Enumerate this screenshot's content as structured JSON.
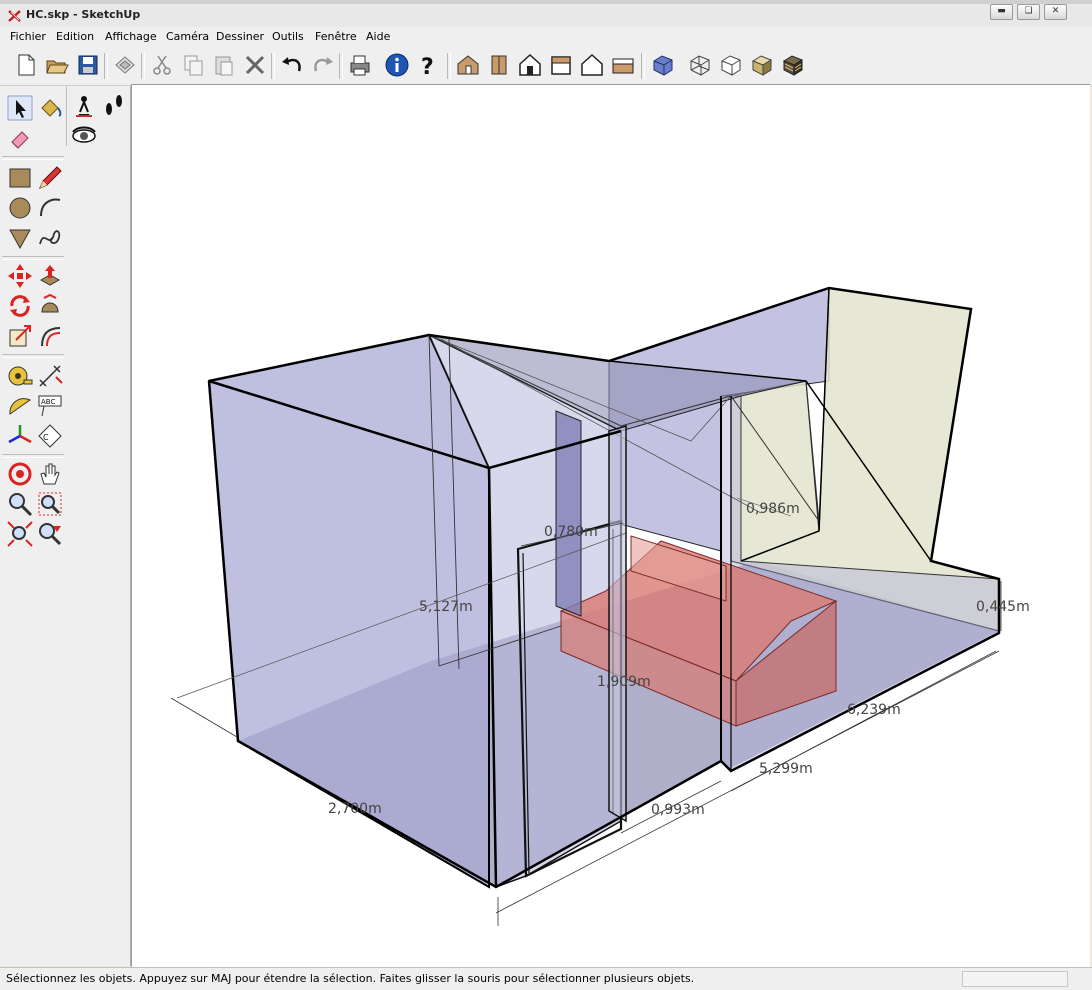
{
  "window": {
    "title": "HC.skp - SketchUp",
    "minimize_icon": "minimize-icon",
    "maximize_icon": "restore-icon",
    "close_icon": "close-icon"
  },
  "menu": [
    {
      "label": "Fichier"
    },
    {
      "label": "Edition"
    },
    {
      "label": "Affichage"
    },
    {
      "label": "Caméra"
    },
    {
      "label": "Dessiner"
    },
    {
      "label": "Outils"
    },
    {
      "label": "Fenêtre"
    },
    {
      "label": "Aide"
    }
  ],
  "toolbar": {
    "icons": [
      "new-file-icon",
      "open-file-icon",
      "save-icon",
      "make-component-icon",
      "cut-icon",
      "copy-icon",
      "paste-icon",
      "erase-icon",
      "undo-icon",
      "redo-icon",
      "print-icon",
      "model-info-icon",
      "help-icon",
      "iso-view-icon",
      "top-view-icon",
      "front-view-icon",
      "right-view-icon",
      "back-view-icon",
      "left-view-icon",
      "xray-style-icon",
      "wireframe-style-icon",
      "hidden-line-style-icon",
      "shaded-style-icon",
      "textured-style-icon"
    ]
  },
  "left_tools": {
    "icons": [
      "select-icon",
      "paint-bucket-icon",
      "eraser-icon",
      "position-camera-icon",
      "walk-icon",
      "look-around-icon",
      "rectangle-icon",
      "pencil-icon",
      "circle-icon",
      "arc-icon",
      "polygon-icon",
      "freehand-icon",
      "move-icon",
      "push-pull-icon",
      "rotate-icon",
      "follow-me-icon",
      "scale-icon",
      "offset-icon",
      "tape-measure-icon",
      "dimension-icon",
      "protractor-icon",
      "text-icon",
      "axes-icon",
      "3d-text-icon",
      "orbit-icon",
      "pan-icon",
      "zoom-icon",
      "zoom-window-icon",
      "zoom-extents-icon",
      "previous-view-icon"
    ]
  },
  "dimensions": {
    "d1": "5,127m",
    "d2": "0,780m",
    "d3": "1,909m",
    "d4": "2,700m",
    "d5": "0,993m",
    "d6": "5,299m",
    "d7": "6,239m",
    "d8": "0,445m",
    "d9": "0,986m"
  },
  "colors": {
    "wall": "#a9a9d4",
    "floor": "#9494b8",
    "ramp": "#e3e3cf",
    "furniture": "#d97a72",
    "edges": "#000000"
  },
  "status": {
    "message": "Sélectionnez les objets. Appuyez sur MAJ pour étendre la sélection. Faites glisser la souris pour sélectionner plusieurs objets."
  }
}
